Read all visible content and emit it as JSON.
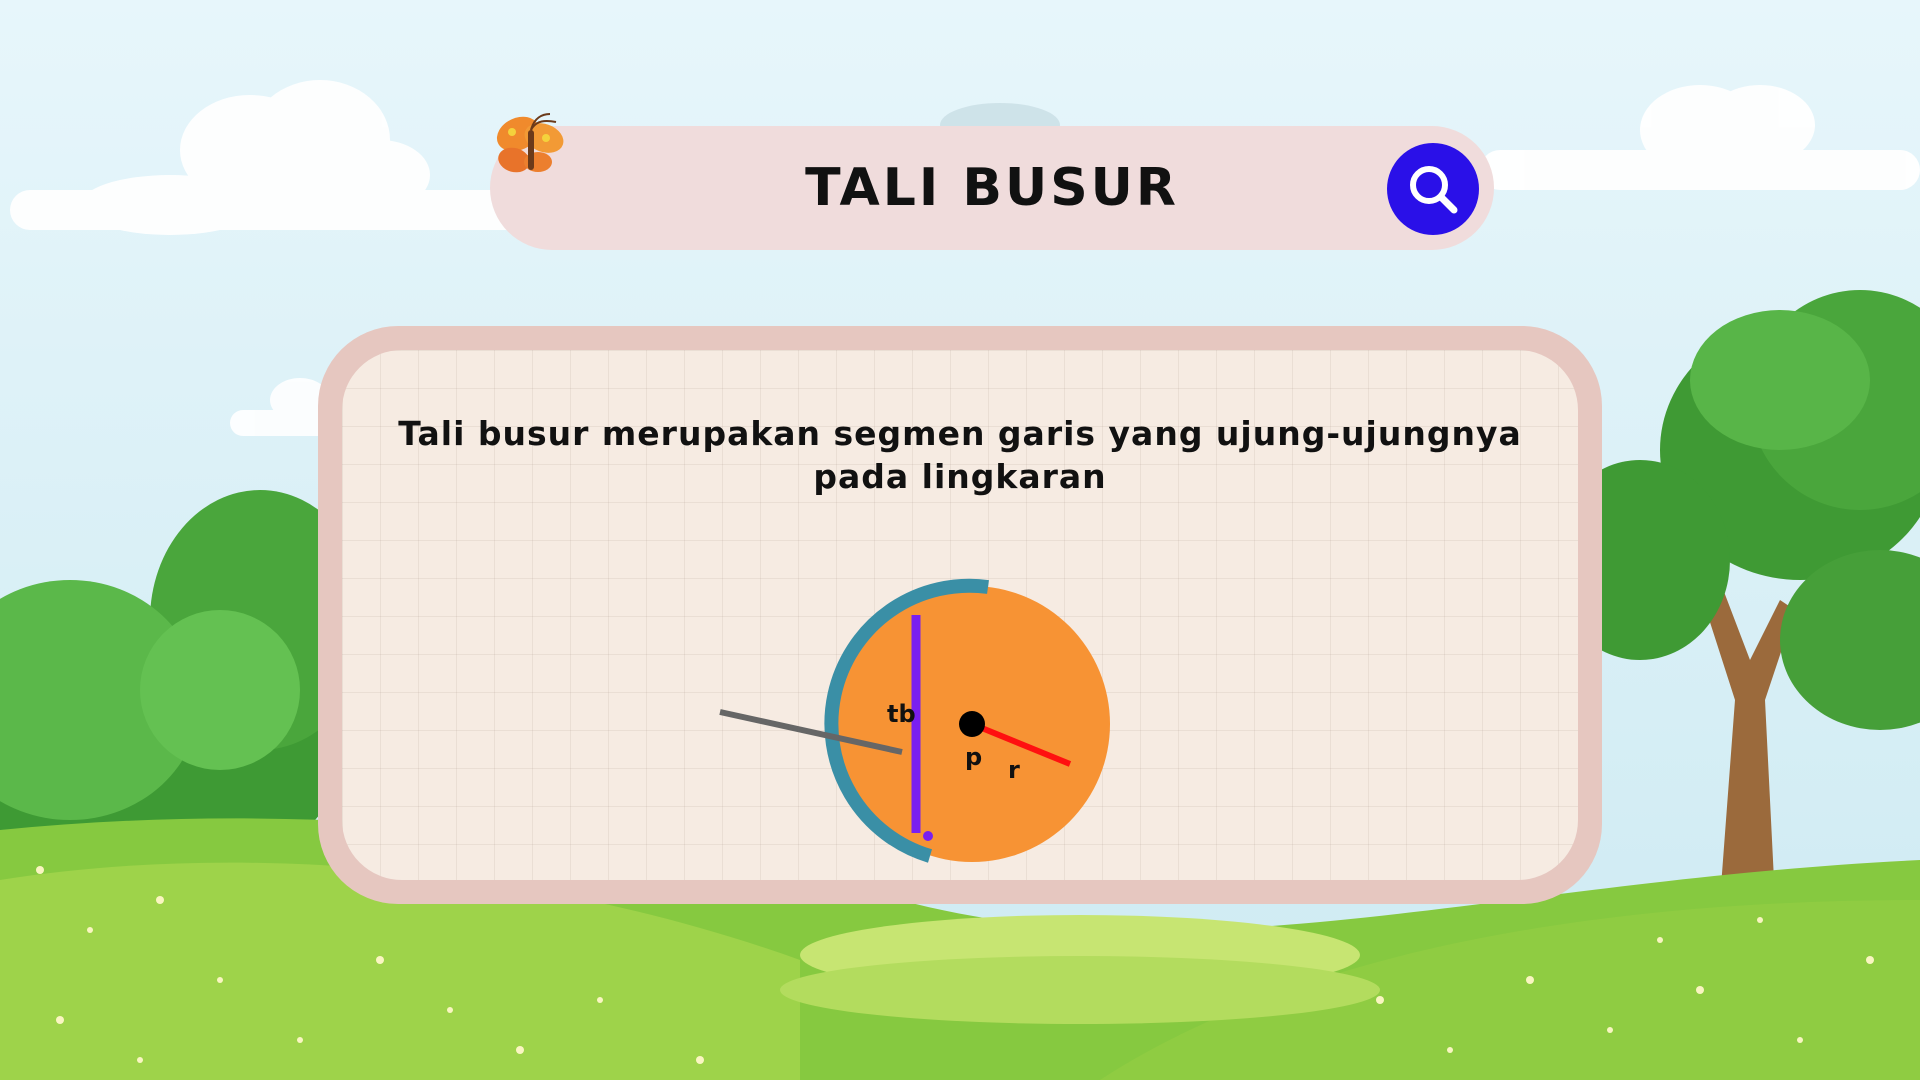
{
  "title": "TALI BUSUR",
  "description": "Tali busur merupakan segmen garis yang ujung-ujungnya pada lingkaran",
  "diagram": {
    "label_chord": "tb",
    "label_center": "p",
    "label_radius": "r"
  },
  "icons": {
    "search": "search-icon",
    "butterfly": "butterfly-icon"
  },
  "colors": {
    "circle_fill": "#f79334",
    "arc": "#3a8fa6",
    "chord": "#7a1ff0",
    "radius": "#ff1010",
    "pointer": "#666666",
    "search_button": "#2a10e8",
    "title_bar": "#f0dcdc",
    "card_border": "#e6c7c0",
    "card_bg": "#f6ebe2"
  }
}
